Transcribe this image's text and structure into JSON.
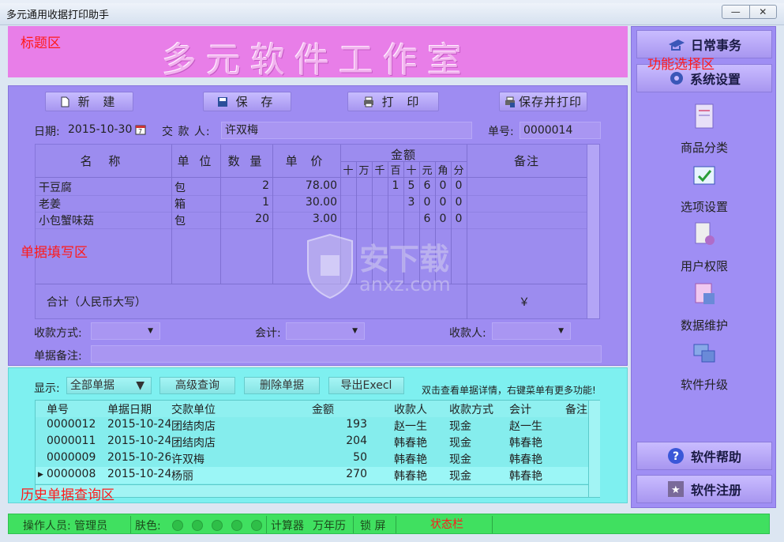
{
  "window": {
    "title": "多元通用收据打印助手",
    "minimize": "—",
    "close": "✕"
  },
  "regions": {
    "title_area": "标题区",
    "big_title": "多元软件工作室",
    "function_area": "功能选择区",
    "form_area": "单据填写区",
    "history_area": "历史单据查询区",
    "status_area": "状态栏"
  },
  "toolbar": {
    "new": "新 建",
    "save": "保 存",
    "print": "打 印",
    "save_print": "保存并打印"
  },
  "form": {
    "date_label": "日期:",
    "date_value": "2015-10-30",
    "payer_label": "交 款 人:",
    "payer_value": "许双梅",
    "no_label": "单号:",
    "no_value": "0000014",
    "headers": {
      "name": "名 称",
      "unit": "单 位",
      "qty": "数 量",
      "price": "单 价",
      "amount": "金额",
      "remark": "备注"
    },
    "digit_headers": [
      "十",
      "万",
      "千",
      "百",
      "十",
      "元",
      "角",
      "分"
    ],
    "rows": [
      {
        "name": "干豆腐",
        "unit": "包",
        "qty": "2",
        "price": "78.00",
        "digits": [
          "",
          "",
          "",
          "1",
          "5",
          "6",
          "0",
          "0"
        ]
      },
      {
        "name": "老姜",
        "unit": "箱",
        "qty": "1",
        "price": "30.00",
        "digits": [
          "",
          "",
          "",
          "",
          "3",
          "0",
          "0",
          "0"
        ]
      },
      {
        "name": "小包蟹味菇",
        "unit": "包",
        "qty": "20",
        "price": "3.00",
        "digits": [
          "",
          "",
          "",
          "",
          "",
          "6",
          "0",
          "0"
        ]
      }
    ],
    "total_label": "合计（人民币大写）",
    "total_symbol": "￥",
    "pay_method_label": "收款方式:",
    "accountant_label": "会计:",
    "receiver_label": "收款人:",
    "note_label": "单据备注:"
  },
  "history": {
    "show_label": "显示:",
    "filter_value": "全部单据",
    "adv_query": "高级查询",
    "delete": "删除单据",
    "export": "导出Execl",
    "hint": "双击查看单据详情，右键菜单有更多功能!",
    "columns": [
      "单号",
      "单据日期",
      "交款单位",
      "金额",
      "收款人",
      "收款方式",
      "会计",
      "备注"
    ],
    "rows": [
      [
        "0000012",
        "2015-10-24",
        "团结肉店",
        "193",
        "赵一生",
        "现金",
        "赵一生",
        ""
      ],
      [
        "0000011",
        "2015-10-24",
        "团结肉店",
        "204",
        "韩春艳",
        "现金",
        "韩春艳",
        ""
      ],
      [
        "0000009",
        "2015-10-26",
        "许双梅",
        "50",
        "韩春艳",
        "现金",
        "韩春艳",
        ""
      ],
      [
        "0000008",
        "2015-10-24",
        "杨丽",
        "270",
        "韩春艳",
        "现金",
        "韩春艳",
        ""
      ]
    ]
  },
  "sidebar": {
    "daily": "日常事务",
    "system": "系统设置",
    "items": [
      "商品分类",
      "选项设置",
      "用户权限",
      "数据维护",
      "软件升级"
    ],
    "help": "软件帮助",
    "register": "软件注册"
  },
  "status": {
    "operator": "操作人员: 管理员",
    "skin": "肤色:",
    "calc": "计算器",
    "calendar": "万年历",
    "lock": "锁 屏"
  },
  "watermark": {
    "name": "安下载",
    "url": "anxz.com"
  },
  "colors": {
    "title_area": "#e87ee8",
    "form_area": "#9e8cf2",
    "history_area": "#7ef0f0",
    "status_bar": "#40e060",
    "label_red": "#ff1a1a"
  }
}
